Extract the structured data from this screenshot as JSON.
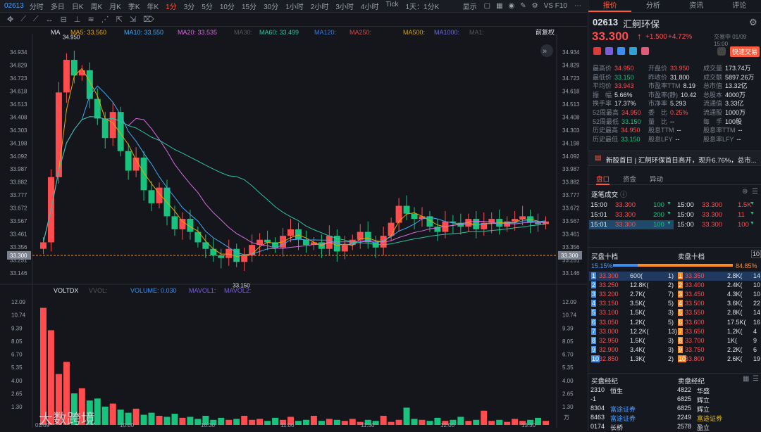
{
  "top": {
    "code": "02613",
    "intervals": [
      "分时",
      "多日",
      "日K",
      "周K",
      "月K",
      "季K",
      "年K",
      "1分",
      "3分",
      "5分",
      "10分",
      "15分",
      "30分",
      "1小时",
      "2小时",
      "3小时",
      "4小时",
      "Tick"
    ],
    "active": "1分",
    "period_sel": "1天：1分K",
    "show": "显示",
    "vs": "VS F10"
  },
  "tools": [
    "✥",
    "⟋",
    "⟋",
    "↔",
    "⊟",
    "⊥",
    "≋",
    "⋰",
    "⇱",
    "⇲",
    "⌦"
  ],
  "legend": {
    "type": "MA",
    "ma5": "MA5: 33.560",
    "ma10": "MA10: 33.550",
    "ma20": "MA20: 33.535",
    "ma30": "MA30:",
    "ma60": "MA60: 33.499",
    "ma120": "MA120:",
    "ma250": "MA250:",
    "ma500": "MA500:",
    "ma1000": "MA1000:",
    "ma1": "MA1:",
    "adj": "前复权"
  },
  "vol_legend": {
    "name": "VOLTDX",
    "vvol": "VVOL:",
    "volume": "VOLUME: 0.030",
    "mavol1": "MAVOL1:",
    "mavol2": "MAVOL2:"
  },
  "price_axis": [
    "34.934",
    "34.829",
    "34.723",
    "34.618",
    "34.513",
    "34.408",
    "34.303",
    "34.198",
    "34.092",
    "33.987",
    "33.882",
    "33.777",
    "33.672",
    "33.567",
    "33.461",
    "33.356",
    "33.251",
    "33.146"
  ],
  "price_axis_r": [
    "34.934",
    "34.829",
    "34.723",
    "34.618",
    "34.513",
    "34.408",
    "34.303",
    "34.198",
    "34.092",
    "33.987",
    "33.882",
    "33.777",
    "33.672",
    "33.567",
    "33.461",
    "33.356",
    "33.251",
    "33.146"
  ],
  "cur_price": "33.300",
  "high_mark": "34.950",
  "low_mark": "33.150",
  "vol_axis": [
    "12.09",
    "10.74",
    "9.39",
    "8.05",
    "6.70",
    "5.35",
    "4.00",
    "2.65",
    "1.30"
  ],
  "vol_unit": "万",
  "time_axis": [
    "01/09",
    "10:00",
    "10:30",
    "11:00",
    "11:30",
    "12:00",
    "13:30"
  ],
  "watermark": "大数跨境",
  "quote": {
    "code": "02613",
    "name": "汇舸环保",
    "price": "33.300",
    "arrow": "↑",
    "chg": "+1.500",
    "pct": "+4.72%",
    "status": "交易中 01/09 15:00",
    "fast": "快速交易"
  },
  "stats": [
    [
      "最高价",
      "34.950",
      "red",
      "开盘价",
      "33.950",
      "red",
      "成交量",
      "173.74万",
      "wht"
    ],
    [
      "最低价",
      "33.150",
      "green",
      "昨收价",
      "31.800",
      "wht",
      "成交额",
      "5897.26万",
      "wht"
    ],
    [
      "平均价",
      "33.943",
      "red",
      "市盈率TTM",
      "8.19",
      "wht",
      "总市值",
      "13.32亿",
      "wht"
    ],
    [
      "振　幅",
      "5.66%",
      "wht",
      "市盈率(静)",
      "10.42",
      "wht",
      "总股本",
      "4000万",
      "wht"
    ],
    [
      "换手率",
      "17.37%",
      "wht",
      "市净率",
      "5.293",
      "wht",
      "流通值",
      "3.33亿",
      "wht"
    ],
    [
      "52周最高",
      "34.950",
      "red",
      "委　比",
      "0.25%",
      "red",
      "流通股",
      "1000万",
      "wht"
    ],
    [
      "52周最低",
      "33.150",
      "green",
      "量　比",
      "--",
      "wht",
      "每　手",
      "100股",
      "wht"
    ],
    [
      "历史最高",
      "34.950",
      "red",
      "股息TTM",
      "--",
      "wht",
      "股息率TTM",
      "--",
      "wht"
    ],
    [
      "历史最低",
      "33.150",
      "green",
      "股息LFY",
      "--",
      "wht",
      "股息率LFY",
      "--",
      "wht"
    ]
  ],
  "news": "新股首日 | 汇舸环保首日高开，现升6.76%，总市...",
  "tabs2": [
    "盘口",
    "资金",
    "异动"
  ],
  "ticks_title": "逐笔成交",
  "ticks": [
    [
      "15:00",
      "33.300",
      "100",
      "15:00",
      "33.300",
      "1.5K"
    ],
    [
      "15:01",
      "33.300",
      "200",
      "15:00",
      "33.300",
      "11"
    ],
    [
      "15:01",
      "33.300",
      "100",
      "15:00",
      "33.300",
      "100"
    ]
  ],
  "ob_titles": {
    "bid": "买盘十档",
    "ask": "卖盘十档",
    "pct_bid": "15.15%",
    "pct_ask": "84.85%",
    "ten": "10"
  },
  "orderbook": [
    [
      "1",
      "33.300",
      "600(",
      "1)",
      "1",
      "33.350",
      "2.8K(",
      "14"
    ],
    [
      "2",
      "33.250",
      "12.8K(",
      "2)",
      "2",
      "33.400",
      "2.4K(",
      "10"
    ],
    [
      "3",
      "33.200",
      "2.7K(",
      "7)",
      "3",
      "33.450",
      "4.3K(",
      "10"
    ],
    [
      "4",
      "33.150",
      "3.5K(",
      "5)",
      "4",
      "33.500",
      "3.6K(",
      "22"
    ],
    [
      "5",
      "33.100",
      "1.5K(",
      "3)",
      "5",
      "33.550",
      "2.8K(",
      "14"
    ],
    [
      "6",
      "33.050",
      "1.2K(",
      "5)",
      "6",
      "33.600",
      "17.5K(",
      "16"
    ],
    [
      "7",
      "33.000",
      "12.2K(",
      "13)",
      "7",
      "33.650",
      "1.2K(",
      "4"
    ],
    [
      "8",
      "32.950",
      "1.5K(",
      "3)",
      "8",
      "33.700",
      "1K(",
      "9"
    ],
    [
      "9",
      "32.900",
      "3.4K(",
      "3)",
      "9",
      "33.750",
      "2.2K(",
      "6"
    ],
    [
      "10",
      "32.850",
      "1.3K(",
      "2)",
      "10",
      "33.800",
      "2.6K(",
      "19"
    ]
  ],
  "brokers_title": {
    "bid": "买盘经纪",
    "ask": "卖盘经纪"
  },
  "brokers_bid": [
    [
      "2310",
      "恒生",
      "wht"
    ],
    [
      "-1",
      "",
      "wht"
    ],
    [
      "8304",
      "富途证券",
      "blue"
    ],
    [
      "8463",
      "富途证券",
      "blue"
    ],
    [
      "0174",
      "长桥",
      "wht"
    ]
  ],
  "brokers_ask": [
    [
      "4822",
      "华盛",
      "wht"
    ],
    [
      "6825",
      "辉立",
      "wht"
    ],
    [
      "6825",
      "辉立",
      "wht"
    ],
    [
      "2249",
      "富途证券",
      "yel"
    ],
    [
      "2578",
      "盈立",
      "wht"
    ]
  ],
  "colors": {
    "up": "#ff4d4f",
    "down": "#19c37d",
    "ma5": "#e6a700",
    "ma10": "#3fa9f5",
    "ma20": "#d56adf",
    "ma60": "#2bc0a0",
    "accent": "#ff5a3c"
  },
  "chart_data": {
    "type": "candlestick",
    "title": "02613 1分K",
    "ylim": [
      33.1,
      35.0
    ],
    "series": [
      {
        "name": "price_close",
        "values": [
          33.4,
          33.9,
          34.55,
          34.8,
          34.68,
          34.72,
          34.5,
          34.35,
          34.2,
          34.4,
          34.1,
          33.95,
          34.05,
          33.8,
          33.7,
          33.82,
          33.6,
          33.5,
          33.58,
          33.48,
          33.4,
          33.35,
          33.3,
          33.28,
          33.35,
          33.25,
          33.3,
          33.38,
          33.42,
          33.4,
          33.36,
          33.45,
          33.5,
          33.42,
          33.38,
          33.4,
          33.35,
          33.45,
          33.33,
          33.38,
          33.42,
          33.48,
          33.4,
          33.36,
          33.45,
          33.55,
          33.68,
          33.62,
          33.58,
          33.6,
          33.52,
          33.48,
          33.56,
          33.55,
          33.52,
          33.58,
          33.5,
          33.55,
          33.58,
          33.52,
          33.56,
          33.58,
          33.6,
          33.55,
          33.54,
          33.56
        ]
      }
    ]
  },
  "volumes": [
    11.5,
    9.3,
    5.0,
    6.2,
    3.1,
    3.6,
    2.4,
    2.6,
    1.8,
    2.1,
    1.5,
    1.2,
    1.6,
    1.0,
    1.2,
    0.9,
    0.8,
    1.1,
    0.7,
    0.8,
    0.6,
    0.9,
    0.5,
    0.7,
    0.5,
    0.6,
    0.9,
    0.5,
    0.6,
    0.4,
    0.7,
    0.5,
    0.8,
    0.4,
    0.5,
    0.9,
    0.4,
    0.6,
    0.5,
    0.4,
    0.6,
    0.3,
    0.5,
    0.4,
    0.9,
    0.3,
    0.5,
    1.7,
    0.6,
    0.5,
    0.4,
    0.7,
    0.4,
    0.5,
    0.8,
    0.4,
    0.5,
    1.4,
    0.4,
    0.5,
    0.3,
    0.6,
    0.4,
    0.5,
    0.7,
    0.4
  ]
}
